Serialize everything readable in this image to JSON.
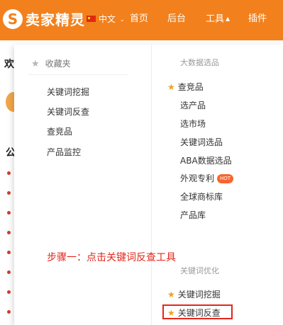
{
  "header": {
    "logo_glyph": "S",
    "logo_text": "卖家精灵",
    "language": "中文",
    "language_arrow": "⌄",
    "nav": [
      {
        "label": "首页"
      },
      {
        "label": "后台"
      },
      {
        "label": "工具",
        "arrow": "▲"
      },
      {
        "label": "插件"
      }
    ],
    "bar_color": "#f2811d"
  },
  "background_page": {
    "welcome": "欢",
    "notice": "公"
  },
  "dropdown": {
    "favorites": {
      "icon": "star-icon",
      "title": "收藏夹",
      "items": [
        "关键词挖掘",
        "关键词反查",
        "查竞品",
        "产品监控"
      ]
    },
    "big_data": {
      "title": "大数据选品",
      "items": [
        {
          "label": "查竞品",
          "starred": true
        },
        {
          "label": "选产品"
        },
        {
          "label": "选市场"
        },
        {
          "label": "关键词选品"
        },
        {
          "label": "ABA数据选品"
        },
        {
          "label": "外观专利",
          "badge": "HOT"
        },
        {
          "label": "全球商标库"
        },
        {
          "label": "产品库"
        }
      ]
    },
    "keyword_opt": {
      "title": "关键词优化",
      "items": [
        {
          "label": "关键词挖掘",
          "starred": true
        },
        {
          "label": "关键词反查",
          "starred": true,
          "highlighted": true
        }
      ]
    }
  },
  "annotation": {
    "step_text": "步骤一：点击关键词反查工具",
    "color": "#e3261b"
  }
}
